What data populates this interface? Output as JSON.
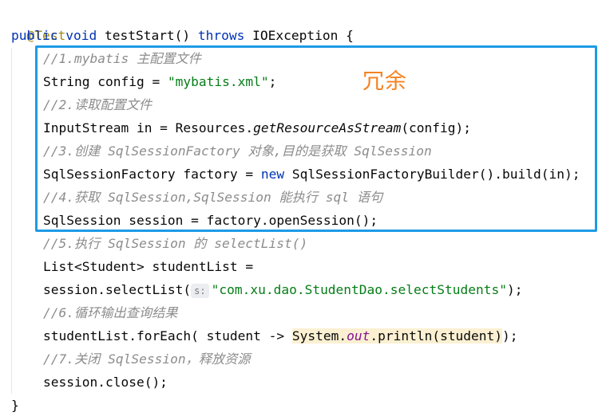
{
  "code": {
    "annotation": "@Test",
    "method_signature": {
      "kw_public": "public",
      "kw_void": "void",
      "name": "testStart()",
      "kw_throws": "throws",
      "exception": "IOException {"
    },
    "comment1": "//1.mybatis 主配置文件",
    "line_config": {
      "decl": "String config = ",
      "value": "\"mybatis.xml\"",
      "end": ";"
    },
    "comment2": "//2.读取配置文件",
    "line_input": {
      "decl": "InputStream in = Resources.",
      "method": "getResourceAsStream",
      "end": "(config);"
    },
    "comment3": "//3.创建 SqlSessionFactory 对象,目的是获取 SqlSession",
    "line_factory": {
      "decl": "SqlSessionFactory factory = ",
      "kw_new": "new",
      "end": " SqlSessionFactoryBuilder().build(in);"
    },
    "comment4": "//4.获取 SqlSession,SqlSession 能执行 sql 语句",
    "line_session": "SqlSession session = factory.openSession();",
    "comment5": "//5.执行 SqlSession 的 selectList()",
    "line_list": "List<Student> studentList =",
    "line_select": {
      "call": "session.selectList(",
      "hint": "s:",
      "value": "\"com.xu.dao.StudentDao.selectStudents\"",
      "end": ");"
    },
    "comment6": "//6.循环输出查询结果",
    "line_foreach": {
      "call": "studentList.forEach( student -> ",
      "sys": "System.",
      "out": "out",
      "println": ".println(student)",
      "end": ");"
    },
    "comment7": "//7.关闭 SqlSession，释放资源",
    "line_close": "session.close();",
    "closing_brace": "}"
  },
  "overlay": {
    "label": "冗余",
    "box_color": "#1e9be6",
    "label_color": "#f58220"
  }
}
